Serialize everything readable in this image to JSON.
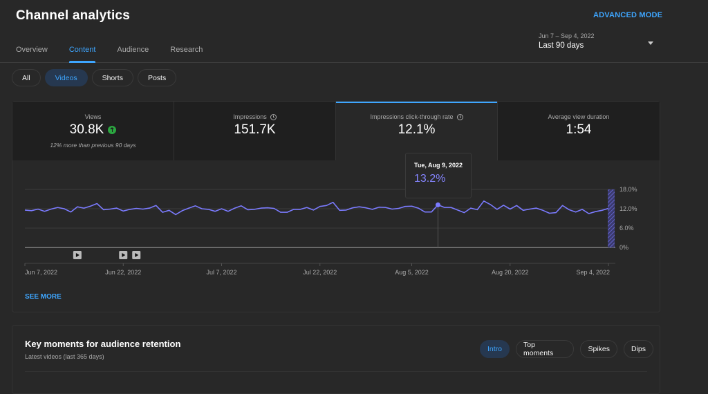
{
  "header": {
    "title": "Channel analytics",
    "advanced_mode": "ADVANCED MODE",
    "tabs": [
      {
        "label": "Overview",
        "active": false
      },
      {
        "label": "Content",
        "active": true
      },
      {
        "label": "Audience",
        "active": false
      },
      {
        "label": "Research",
        "active": false
      }
    ],
    "date_range": {
      "sub": "Jun 7 – Sep 4, 2022",
      "label": "Last 90 days"
    }
  },
  "filter_chips": [
    {
      "label": "All",
      "active": false
    },
    {
      "label": "Videos",
      "active": true
    },
    {
      "label": "Shorts",
      "active": false
    },
    {
      "label": "Posts",
      "active": false
    }
  ],
  "metrics": [
    {
      "label": "Views",
      "value": "30.8K",
      "note": "12% more than previous 90 days",
      "trend": "up",
      "clock": false,
      "active": false
    },
    {
      "label": "Impressions",
      "value": "151.7K",
      "note": "",
      "clock": true,
      "active": false
    },
    {
      "label": "Impressions click-through rate",
      "value": "12.1%",
      "note": "",
      "clock": true,
      "active": true
    },
    {
      "label": "Average view duration",
      "value": "1:54",
      "note": "",
      "clock": false,
      "active": false
    }
  ],
  "tooltip": {
    "date": "Tue, Aug 9, 2022",
    "value": "13.2%"
  },
  "see_more": "SEE MORE",
  "colors": {
    "accent": "#3ea6ff",
    "series": "#7b7bff",
    "positive": "#2ba640"
  },
  "chart_data": {
    "type": "line",
    "title": "Impressions click-through rate",
    "xlabel": "",
    "ylabel": "",
    "ylim": [
      0,
      18
    ],
    "y_ticks": [
      "18.0%",
      "12.0%",
      "6.0%",
      "0%"
    ],
    "y_tick_values": [
      18,
      12,
      6,
      0
    ],
    "x_tick_labels": [
      "Jun 7, 2022",
      "Jun 22, 2022",
      "Jul 7, 2022",
      "Jul 22, 2022",
      "Aug 5, 2022",
      "Aug 20, 2022",
      "Sep 4, 2022"
    ],
    "x_tick_indices": [
      0,
      15,
      30,
      45,
      59,
      74,
      89
    ],
    "grid": true,
    "highlight_index": 63,
    "partial_last_day": true,
    "video_marker_indices": [
      8,
      15,
      17
    ],
    "series": [
      {
        "name": "Impressions click-through rate (%)",
        "values": [
          11.6,
          11.4,
          11.9,
          11.2,
          11.9,
          12.4,
          12.0,
          11.0,
          12.6,
          12.2,
          12.8,
          13.6,
          11.7,
          11.9,
          12.2,
          11.3,
          11.8,
          12.1,
          11.9,
          12.2,
          13.0,
          10.9,
          11.5,
          10.2,
          11.4,
          12.2,
          12.9,
          12.0,
          11.8,
          11.2,
          12.0,
          11.2,
          12.2,
          12.9,
          11.7,
          11.8,
          12.2,
          12.3,
          12.1,
          10.9,
          10.9,
          11.8,
          11.8,
          12.4,
          11.6,
          12.7,
          13.0,
          14.0,
          11.5,
          11.6,
          12.3,
          12.6,
          12.3,
          11.8,
          12.5,
          12.4,
          11.9,
          12.1,
          12.7,
          12.8,
          12.2,
          11.0,
          11.0,
          13.2,
          12.4,
          12.4,
          11.6,
          10.8,
          12.2,
          11.7,
          14.4,
          13.3,
          11.8,
          13.1,
          11.9,
          13.0,
          11.5,
          11.9,
          12.2,
          11.5,
          10.6,
          10.8,
          13.0,
          11.7,
          11.0,
          11.8,
          10.5,
          11.1,
          11.5,
          12.1
        ]
      }
    ]
  },
  "retention": {
    "title": "Key moments for audience retention",
    "subtitle": "Latest videos (last 365 days)",
    "chips": [
      {
        "label": "Intro",
        "active": true
      },
      {
        "label": "Top moments",
        "active": false
      },
      {
        "label": "Spikes",
        "active": false
      },
      {
        "label": "Dips",
        "active": false
      }
    ]
  }
}
